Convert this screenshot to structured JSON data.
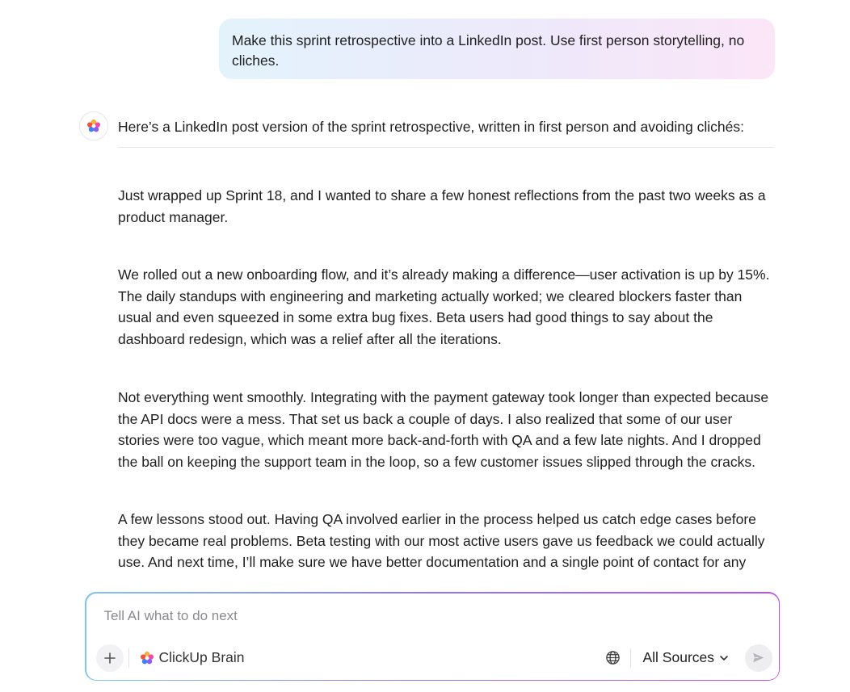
{
  "conversation": {
    "user_message": "Make this sprint retrospective into a LinkedIn post. Use first person storytelling, no cliches.",
    "assistant_intro": "Here’s a LinkedIn post version of the sprint retrospective, written in first person and avoiding clichés:",
    "assistant_paragraphs": [
      "Just wrapped up Sprint 18, and I wanted to share a few honest reflections from the past two weeks as a product manager.",
      "We rolled out a new onboarding flow, and it’s already making a difference—user activation is up by 15%. The daily standups with engineering and marketing actually worked; we cleared blockers faster than usual and even squeezed in some extra bug fixes. Beta users had good things to say about the dashboard redesign, which was a relief after all the iterations.",
      "Not everything went smoothly. Integrating with the payment gateway took longer than expected because the API docs were a mess. That set us back a couple of days. I also realized that some of our user stories were too vague, which meant more back-and-forth with QA and a few late nights. And I dropped the ball on keeping the support team in the loop, so a few customer issues slipped through the cracks.",
      "A few lessons stood out. Having QA involved earlier in the process helped us catch edge cases before they became real problems. Beta testing with our most active users gave us feedback we could actually use. And next time, I’ll make sure we have better documentation and a single point of contact for any"
    ]
  },
  "composer": {
    "placeholder": "Tell AI what to do next",
    "value": "",
    "add_icon": "plus-icon",
    "brain_label": "ClickUp Brain",
    "brain_icon": "clickup-brain-icon",
    "globe_icon": "globe-icon",
    "sources_label": "All Sources",
    "sources_icon": "chevron-down-icon",
    "send_icon": "send-icon"
  },
  "colors": {
    "user_bubble_from": "#e3f3fc",
    "user_bubble_to": "#fbe6f7",
    "composer_border_from": "#7fc7ea",
    "composer_border_to": "#c04fe8"
  }
}
